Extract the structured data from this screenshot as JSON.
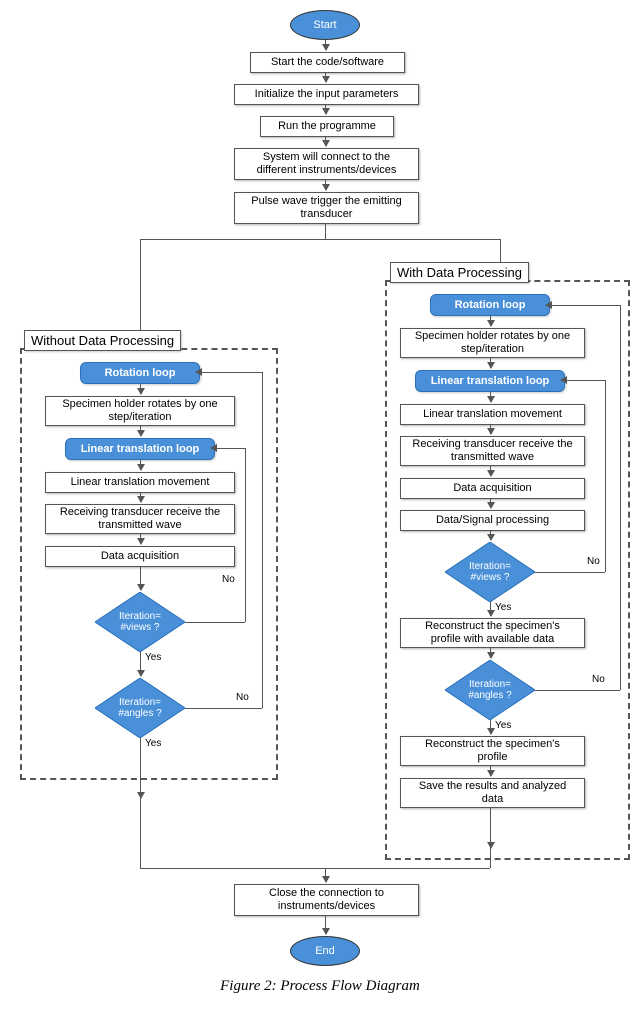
{
  "terminals": {
    "start": "Start",
    "end": "End"
  },
  "top_steps": [
    "Start the code/software",
    "Initialize the input parameters",
    "Run the programme",
    "System will connect to the different instruments/devices",
    "Pulse wave trigger the emitting transducer"
  ],
  "frames": {
    "left_title": "Without Data Processing",
    "right_title": "With Data Processing"
  },
  "loops": {
    "rotation": "Rotation loop",
    "linear": "Linear translation loop"
  },
  "left_steps": {
    "rotate": "Specimen holder rotates by one step/iteration",
    "linear_move": "Linear translation movement",
    "receive": "Receiving transducer receive the transmitted wave",
    "acq": "Data acquisition"
  },
  "right_steps": {
    "rotate": "Specimen holder rotates by one step/iteration",
    "linear_move": "Linear translation movement",
    "receive": "Receiving transducer receive the transmitted wave",
    "acq": "Data acquisition",
    "proc": "Data/Signal processing",
    "recon_avail": "Reconstruct the specimen's profile with available data",
    "recon": "Reconstruct the specimen's profile",
    "save": "Save the results and analyzed data"
  },
  "decisions": {
    "views": "Iteration=\n#views ?",
    "angles": "Iteration=\n#angles ?"
  },
  "labels": {
    "yes": "Yes",
    "no": "No"
  },
  "bottom_step": "Close the connection to instruments/devices",
  "caption": "Figure 2: Process Flow Diagram",
  "chart_data": {
    "type": "flowchart",
    "nodes": [
      {
        "id": "start",
        "type": "terminal",
        "label": "Start"
      },
      {
        "id": "s1",
        "type": "process",
        "label": "Start the code/software"
      },
      {
        "id": "s2",
        "type": "process",
        "label": "Initialize the input parameters"
      },
      {
        "id": "s3",
        "type": "process",
        "label": "Run the programme"
      },
      {
        "id": "s4",
        "type": "process",
        "label": "System will connect to the different instruments/devices"
      },
      {
        "id": "s5",
        "type": "process",
        "label": "Pulse wave trigger the emitting transducer"
      },
      {
        "id": "frameL",
        "type": "group",
        "label": "Without Data Processing"
      },
      {
        "id": "frameR",
        "type": "group",
        "label": "With Data Processing"
      },
      {
        "id": "L_rot",
        "type": "loop",
        "label": "Rotation loop",
        "parent": "frameL"
      },
      {
        "id": "L_r1",
        "type": "process",
        "label": "Specimen holder rotates by one step/iteration",
        "parent": "frameL"
      },
      {
        "id": "L_lin",
        "type": "loop",
        "label": "Linear translation loop",
        "parent": "frameL"
      },
      {
        "id": "L_r2",
        "type": "process",
        "label": "Linear translation movement",
        "parent": "frameL"
      },
      {
        "id": "L_r3",
        "type": "process",
        "label": "Receiving transducer receive the transmitted wave",
        "parent": "frameL"
      },
      {
        "id": "L_r4",
        "type": "process",
        "label": "Data acquisition",
        "parent": "frameL"
      },
      {
        "id": "L_d1",
        "type": "decision",
        "label": "Iteration=#views ?",
        "parent": "frameL"
      },
      {
        "id": "L_d2",
        "type": "decision",
        "label": "Iteration=#angles ?",
        "parent": "frameL"
      },
      {
        "id": "R_rot",
        "type": "loop",
        "label": "Rotation loop",
        "parent": "frameR"
      },
      {
        "id": "R_r1",
        "type": "process",
        "label": "Specimen holder rotates by one step/iteration",
        "parent": "frameR"
      },
      {
        "id": "R_lin",
        "type": "loop",
        "label": "Linear translation loop",
        "parent": "frameR"
      },
      {
        "id": "R_r2",
        "type": "process",
        "label": "Linear translation movement",
        "parent": "frameR"
      },
      {
        "id": "R_r3",
        "type": "process",
        "label": "Receiving transducer receive the transmitted wave",
        "parent": "frameR"
      },
      {
        "id": "R_r4",
        "type": "process",
        "label": "Data acquisition",
        "parent": "frameR"
      },
      {
        "id": "R_r5",
        "type": "process",
        "label": "Data/Signal processing",
        "parent": "frameR"
      },
      {
        "id": "R_d1",
        "type": "decision",
        "label": "Iteration=#views ?",
        "parent": "frameR"
      },
      {
        "id": "R_r6",
        "type": "process",
        "label": "Reconstruct the specimen's profile with available data",
        "parent": "frameR"
      },
      {
        "id": "R_d2",
        "type": "decision",
        "label": "Iteration=#angles ?",
        "parent": "frameR"
      },
      {
        "id": "R_r7",
        "type": "process",
        "label": "Reconstruct the specimen's profile",
        "parent": "frameR"
      },
      {
        "id": "R_r8",
        "type": "process",
        "label": "Save the results and analyzed data",
        "parent": "frameR"
      },
      {
        "id": "close",
        "type": "process",
        "label": "Close the connection to instruments/devices"
      },
      {
        "id": "end",
        "type": "terminal",
        "label": "End"
      }
    ],
    "edges": [
      {
        "from": "start",
        "to": "s1"
      },
      {
        "from": "s1",
        "to": "s2"
      },
      {
        "from": "s2",
        "to": "s3"
      },
      {
        "from": "s3",
        "to": "s4"
      },
      {
        "from": "s4",
        "to": "s5"
      },
      {
        "from": "s5",
        "to": "frameL"
      },
      {
        "from": "s5",
        "to": "frameR"
      },
      {
        "from": "L_rot",
        "to": "L_r1"
      },
      {
        "from": "L_r1",
        "to": "L_lin"
      },
      {
        "from": "L_lin",
        "to": "L_r2"
      },
      {
        "from": "L_r2",
        "to": "L_r3"
      },
      {
        "from": "L_r3",
        "to": "L_r4"
      },
      {
        "from": "L_r4",
        "to": "L_d1"
      },
      {
        "from": "L_d1",
        "to": "L_lin",
        "label": "No"
      },
      {
        "from": "L_d1",
        "to": "L_d2",
        "label": "Yes"
      },
      {
        "from": "L_d2",
        "to": "L_rot",
        "label": "No"
      },
      {
        "from": "L_d2",
        "to": "close",
        "label": "Yes"
      },
      {
        "from": "R_rot",
        "to": "R_r1"
      },
      {
        "from": "R_r1",
        "to": "R_lin"
      },
      {
        "from": "R_lin",
        "to": "R_r2"
      },
      {
        "from": "R_r2",
        "to": "R_r3"
      },
      {
        "from": "R_r3",
        "to": "R_r4"
      },
      {
        "from": "R_r4",
        "to": "R_r5"
      },
      {
        "from": "R_r5",
        "to": "R_d1"
      },
      {
        "from": "R_d1",
        "to": "R_lin",
        "label": "No"
      },
      {
        "from": "R_d1",
        "to": "R_r6",
        "label": "Yes"
      },
      {
        "from": "R_r6",
        "to": "R_d2"
      },
      {
        "from": "R_d2",
        "to": "R_rot",
        "label": "No"
      },
      {
        "from": "R_d2",
        "to": "R_r7",
        "label": "Yes"
      },
      {
        "from": "R_r7",
        "to": "R_r8"
      },
      {
        "from": "R_r8",
        "to": "close"
      },
      {
        "from": "close",
        "to": "end"
      }
    ]
  }
}
